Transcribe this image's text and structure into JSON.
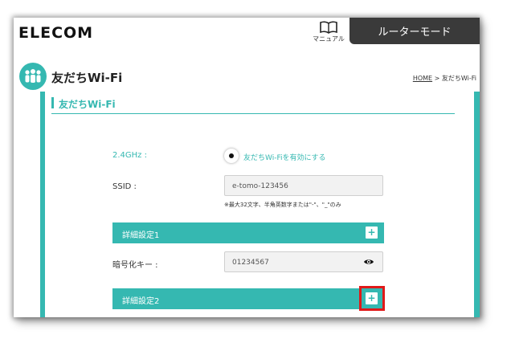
{
  "header": {
    "logo": "ELECOM",
    "manual_label": "マニュアル",
    "mode_button": "ルーターモード"
  },
  "page": {
    "title": "友だちWi-Fi",
    "breadcrumb_home": "HOME",
    "breadcrumb_sep": " > ",
    "breadcrumb_current": "友だちWi-Fi",
    "section_title": "友だちWi-Fi"
  },
  "form": {
    "band_label": "2.4GHz :",
    "enable_label": "友だちWi-Fiを有効にする",
    "enable_checked": true,
    "ssid_label": "SSID :",
    "ssid_value": "e-tomo-123456",
    "ssid_hint": "※最大32文字、半角英数字または\"-\"、\"_\"のみ",
    "advanced1_label": "詳細設定1",
    "key_label": "暗号化キー :",
    "key_value": "01234567",
    "advanced2_label": "詳細設定2",
    "plus_symbol": "+"
  },
  "colors": {
    "accent": "#35b8b1",
    "highlight": "#e01919",
    "mode_button_bg": "#3a3a3a"
  }
}
